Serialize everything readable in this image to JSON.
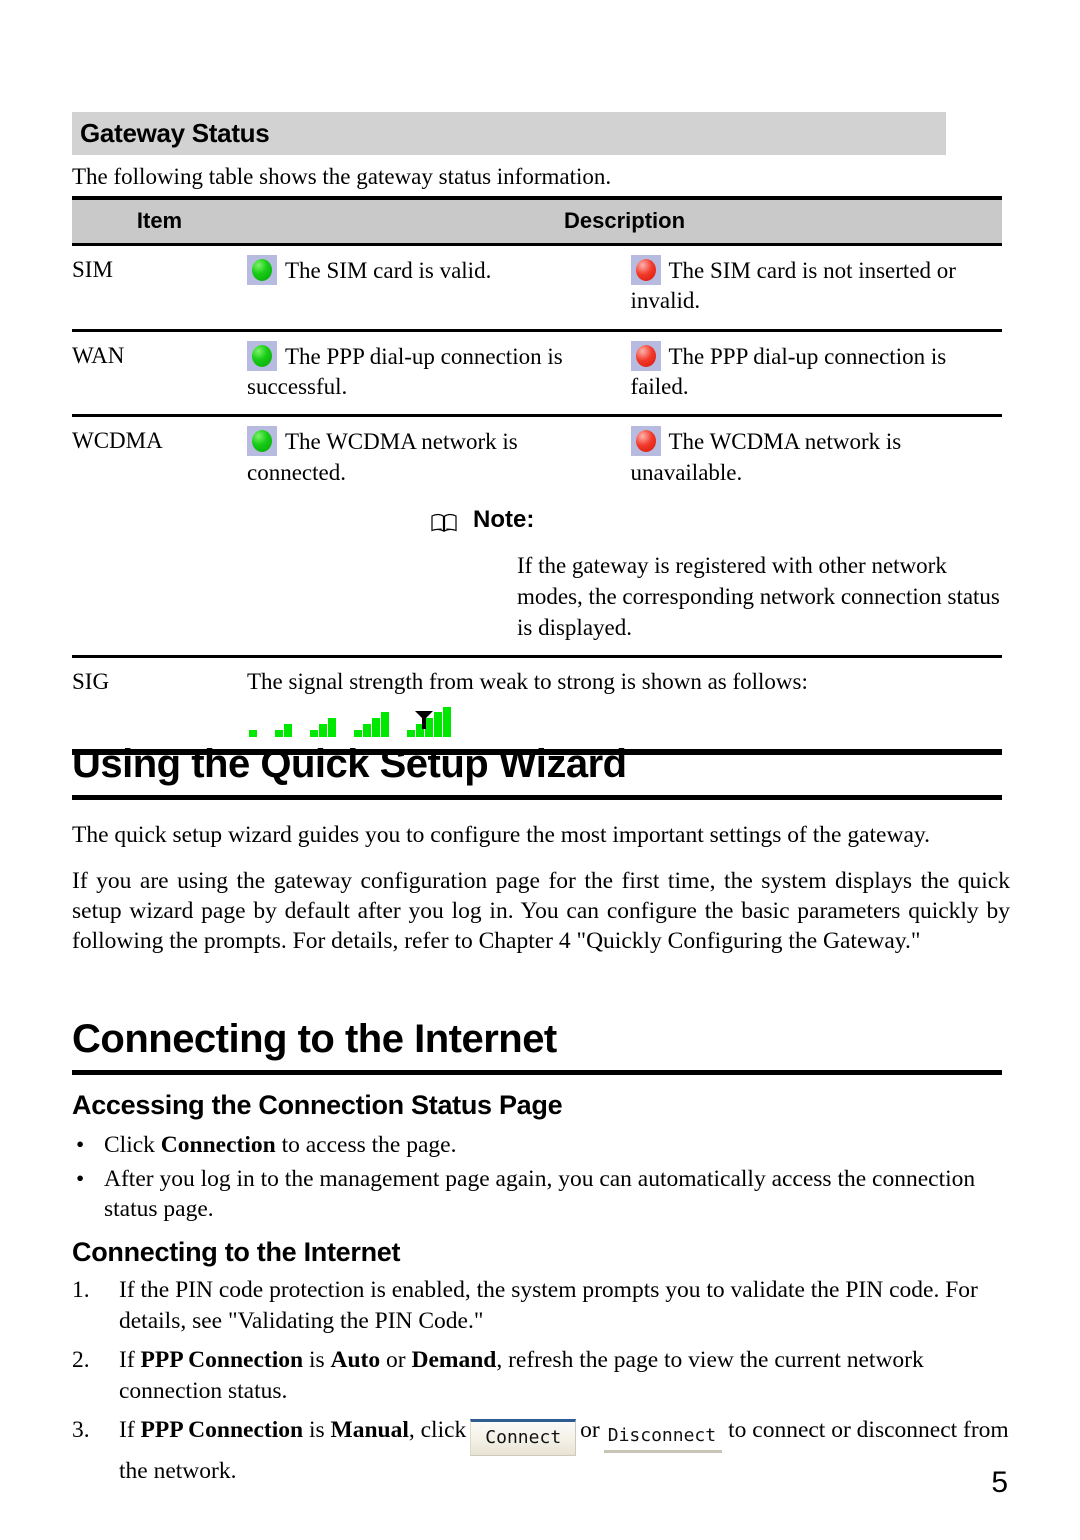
{
  "gateway_status": {
    "heading": "Gateway Status",
    "intro": "The following table shows the gateway status information.",
    "table": {
      "headers": {
        "item": "Item",
        "description": "Description"
      },
      "rows": [
        {
          "item": "SIM",
          "ok_icon": "green-led-icon",
          "ok_text": "The SIM card is valid.",
          "fail_icon": "red-led-icon",
          "fail_text": "The SIM card is not inserted or invalid."
        },
        {
          "item": "WAN",
          "ok_icon": "green-led-icon",
          "ok_text": "The PPP dial-up connection is successful.",
          "fail_icon": "red-led-icon",
          "fail_text": "The PPP dial-up connection is failed."
        },
        {
          "item": "WCDMA",
          "ok_icon": "green-led-icon",
          "ok_text": "The WCDMA network is connected.",
          "fail_icon": "red-led-icon",
          "fail_text": "The WCDMA network is unavailable."
        }
      ],
      "note": {
        "icon": "open-book-icon",
        "label": "Note:",
        "body": "If the gateway is registered with other network modes, the corresponding network connection status is displayed."
      },
      "sig_row": {
        "item": "SIG",
        "text": "The signal strength from weak to strong is shown as follows:",
        "levels": [
          1,
          2,
          3,
          4,
          5
        ],
        "bar_color": "#00e800"
      }
    }
  },
  "quick_setup": {
    "heading": "Using the Quick Setup Wizard",
    "paragraph1": "The quick setup wizard guides you to configure the most important settings of the gateway.",
    "paragraph2": "If you are using the gateway configuration page for the first time, the system displays the quick setup wizard page by default after you log in. You can configure the basic parameters quickly by following the prompts. For details, refer to Chapter 4 \"Quickly Configuring the Gateway.\""
  },
  "connecting": {
    "heading": "Connecting to the Internet",
    "accessing": {
      "heading": "Accessing the Connection Status Page",
      "bullets": [
        {
          "prefix": "Click ",
          "bold": "Connection",
          "suffix": " to access the page."
        },
        {
          "prefix": "After you log in to the management page again, you can automatically access the connection status page.",
          "bold": "",
          "suffix": ""
        }
      ]
    },
    "subsection": {
      "heading": "Connecting to the Internet",
      "steps": [
        {
          "num": "1.",
          "text": "If the PIN code protection is enabled, the system prompts you to validate the PIN code. For details, see \"Validating the PIN Code.\""
        },
        {
          "num": "2.",
          "text": "If PPP Connection is Auto or Demand, refresh the page to view the current network connection status."
        },
        {
          "num": "3.",
          "text": "If PPP Connection is Manual, click Connect or Disconnect to connect or disconnect from the network."
        }
      ],
      "step2_parts": {
        "a": "If ",
        "b_bold": "PPP Connection",
        "c": " is ",
        "d_bold": "Auto",
        "e": " or ",
        "f_bold": "Demand",
        "g": ", refresh the page to view the current network connection status."
      },
      "step3_parts": {
        "a": "If ",
        "b_bold": "PPP Connection",
        "c": " is ",
        "d_bold": "Manual",
        "e": ", click",
        "connect_label": "Connect",
        "or_label": "or",
        "disconnect_label": "Disconnect",
        "tail": "to connect or disconnect from the network."
      }
    }
  },
  "footer": {
    "page_number": "5"
  },
  "colors": {
    "heading_band": "#d2d2d2",
    "table_header_bg": "#c9c9c9",
    "led_bg": "#b8bbe0",
    "led_green": "#17cc16",
    "led_red": "#f23a2b",
    "signal_green": "#00e800",
    "button_accent": "#2f5d93"
  }
}
